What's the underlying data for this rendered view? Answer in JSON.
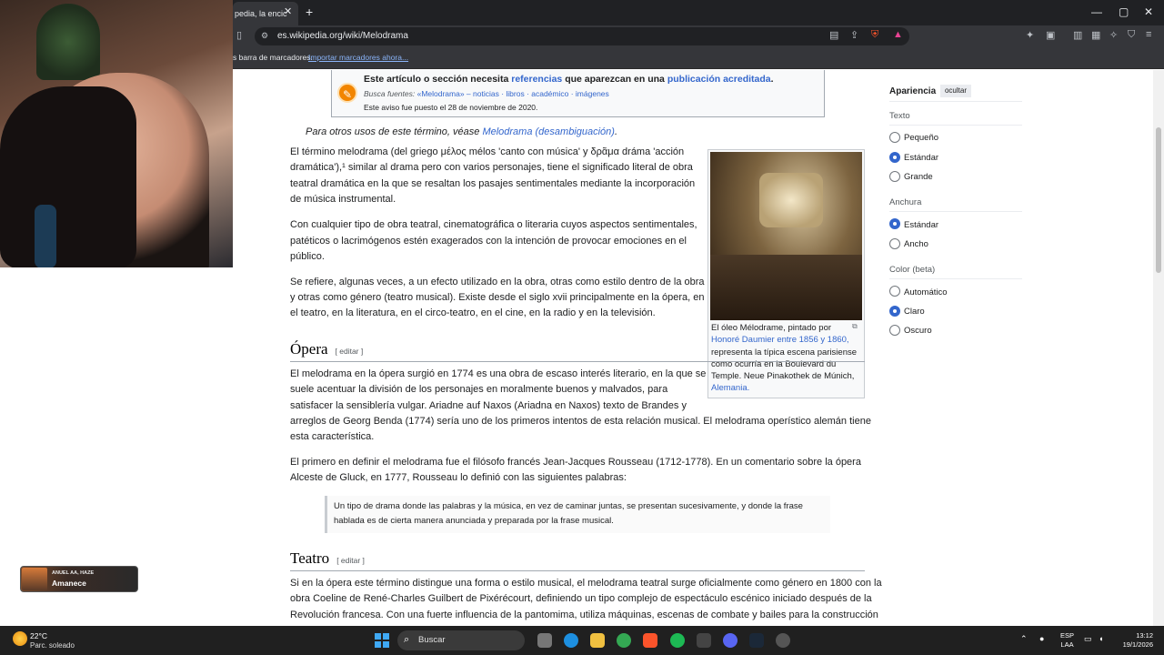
{
  "browser": {
    "tab_title": "pedia, la encic",
    "tab_close": "✕",
    "new_tab": "+",
    "url": "es.wikipedia.org/wiki/Melodrama",
    "bookmarks_text": "s barra de marcadores.",
    "bookmarks_link": "Importar marcadores ahora...",
    "window_controls": [
      "—",
      "▢",
      "✕"
    ]
  },
  "notice": {
    "line1_pre": "Este artículo o sección necesita ",
    "line1_link1": "referencias",
    "line1_mid": " que aparezcan en una ",
    "line1_link2": "publicación acreditada",
    "line1_post": ".",
    "line2_pre": "Busca fuentes: ",
    "line2_links": "«Melodrama» – noticias · libros · académico · imágenes",
    "line3": "Este aviso fue puesto el 28 de noviembre de 2020."
  },
  "hatnote": {
    "pre": "Para otros usos de este término, véase ",
    "link": "Melodrama (desambiguación)",
    "post": "."
  },
  "paragraphs": {
    "p1_l1": "El término melodrama (del griego μέλος mélos 'canto con música' y δρᾶμα dráma 'acción",
    "p1_l2": "dramática'),¹  similar al drama pero con varios personajes, tiene el significado literal de obra",
    "p1_l3": "teatral dramática en la que se resaltan los pasajes sentimentales mediante la incorporación",
    "p1_l4": "de música instrumental.",
    "p2_l1": "Con cualquier tipo de obra teatral, cinematográfica o literaria cuyos aspectos sentimentales,",
    "p2_l2": "patéticos o lacrimógenos estén exagerados con la intención de provocar emociones en el",
    "p2_l3": "público.",
    "p3_l1": "Se refiere, algunas veces, a un efecto utilizado en la obra, otras como estilo dentro de la obra",
    "p3_l2": "y otras como género (teatro musical). Existe desde el siglo xvii principalmente en la ópera, en",
    "p3_l3": "el teatro, en la literatura, en el circo-teatro, en el cine, en la radio y en la televisión.",
    "p4_l1": "El melodrama en la ópera surgió en 1774 es una obra de escaso interés literario, en la que se",
    "p4_l2": "suele acentuar la división de los personajes en moralmente buenos y malvados, para",
    "p4_l3": "satisfacer la sensiblería vulgar. Ariadne auf Naxos (Ariadna en Naxos) texto de Brandes y",
    "p4_l4": "arreglos de Georg Benda (1774) sería uno de los primeros intentos de esta relación musical. El melodrama operístico alemán tiene",
    "p4_l5": "esta característica.",
    "p5_l1": "El primero en definir el melodrama fue el filósofo francés Jean-Jacques Rousseau (1712-1778). En un comentario sobre la ópera",
    "p5_l2": "Alceste de Gluck, en 1777, Rousseau lo definió con las siguientes palabras:",
    "quote_l1": "Un tipo de drama donde las palabras y la música, en vez de caminar juntas, se presentan sucesivamente, y donde la frase",
    "quote_l2": "hablada es de cierta manera anunciada y preparada por la frase musical.",
    "p6_l1": "Si en la ópera este término distingue una forma o estilo musical, el melodrama teatral surge oficialmente como género en 1800 con la",
    "p6_l2": "obra Coeline de René-Charles Guilbert de Pixérécourt, definiendo un tipo complejo de espectáculo escénico iniciado después de la",
    "p6_l3": "Revolución francesa. Con una fuerte influencia de la pantomima, utiliza máquinas, escenas de combate y bailes para la construcción"
  },
  "headings": {
    "opera": "Ópera",
    "teatro": "Teatro",
    "edit": "[ editar ]"
  },
  "infobox": {
    "caption_l1": "El óleo Mélodrame, pintado por",
    "caption_l2": "Honoré Daumier entre 1856 y 1860,",
    "caption_l3": "representa la típica escena parisiense",
    "caption_l4": "como ocurría en la Boulevard du",
    "caption_l5": "Temple. Neue Pinakothek de Múnich,",
    "caption_l6": "Alemania."
  },
  "appearance": {
    "title": "Apariencia",
    "hide": "ocultar",
    "text_label": "Texto",
    "text_options": [
      "Pequeño",
      "Estándar",
      "Grande"
    ],
    "width_label": "Anchura",
    "width_options": [
      "Estándar",
      "Ancho"
    ],
    "color_label": "Color (beta)",
    "color_options": [
      "Automático",
      "Claro",
      "Oscuro"
    ]
  },
  "music": {
    "artist": "ANUEL AA, HAZE",
    "song": "Amanece"
  },
  "taskbar": {
    "temp": "22°C",
    "weather": "Parc. soleado",
    "search": "Buscar",
    "lang_l1": "ESP",
    "lang_l2": "LAA",
    "time": "13:12",
    "date": "19/1/2026"
  }
}
